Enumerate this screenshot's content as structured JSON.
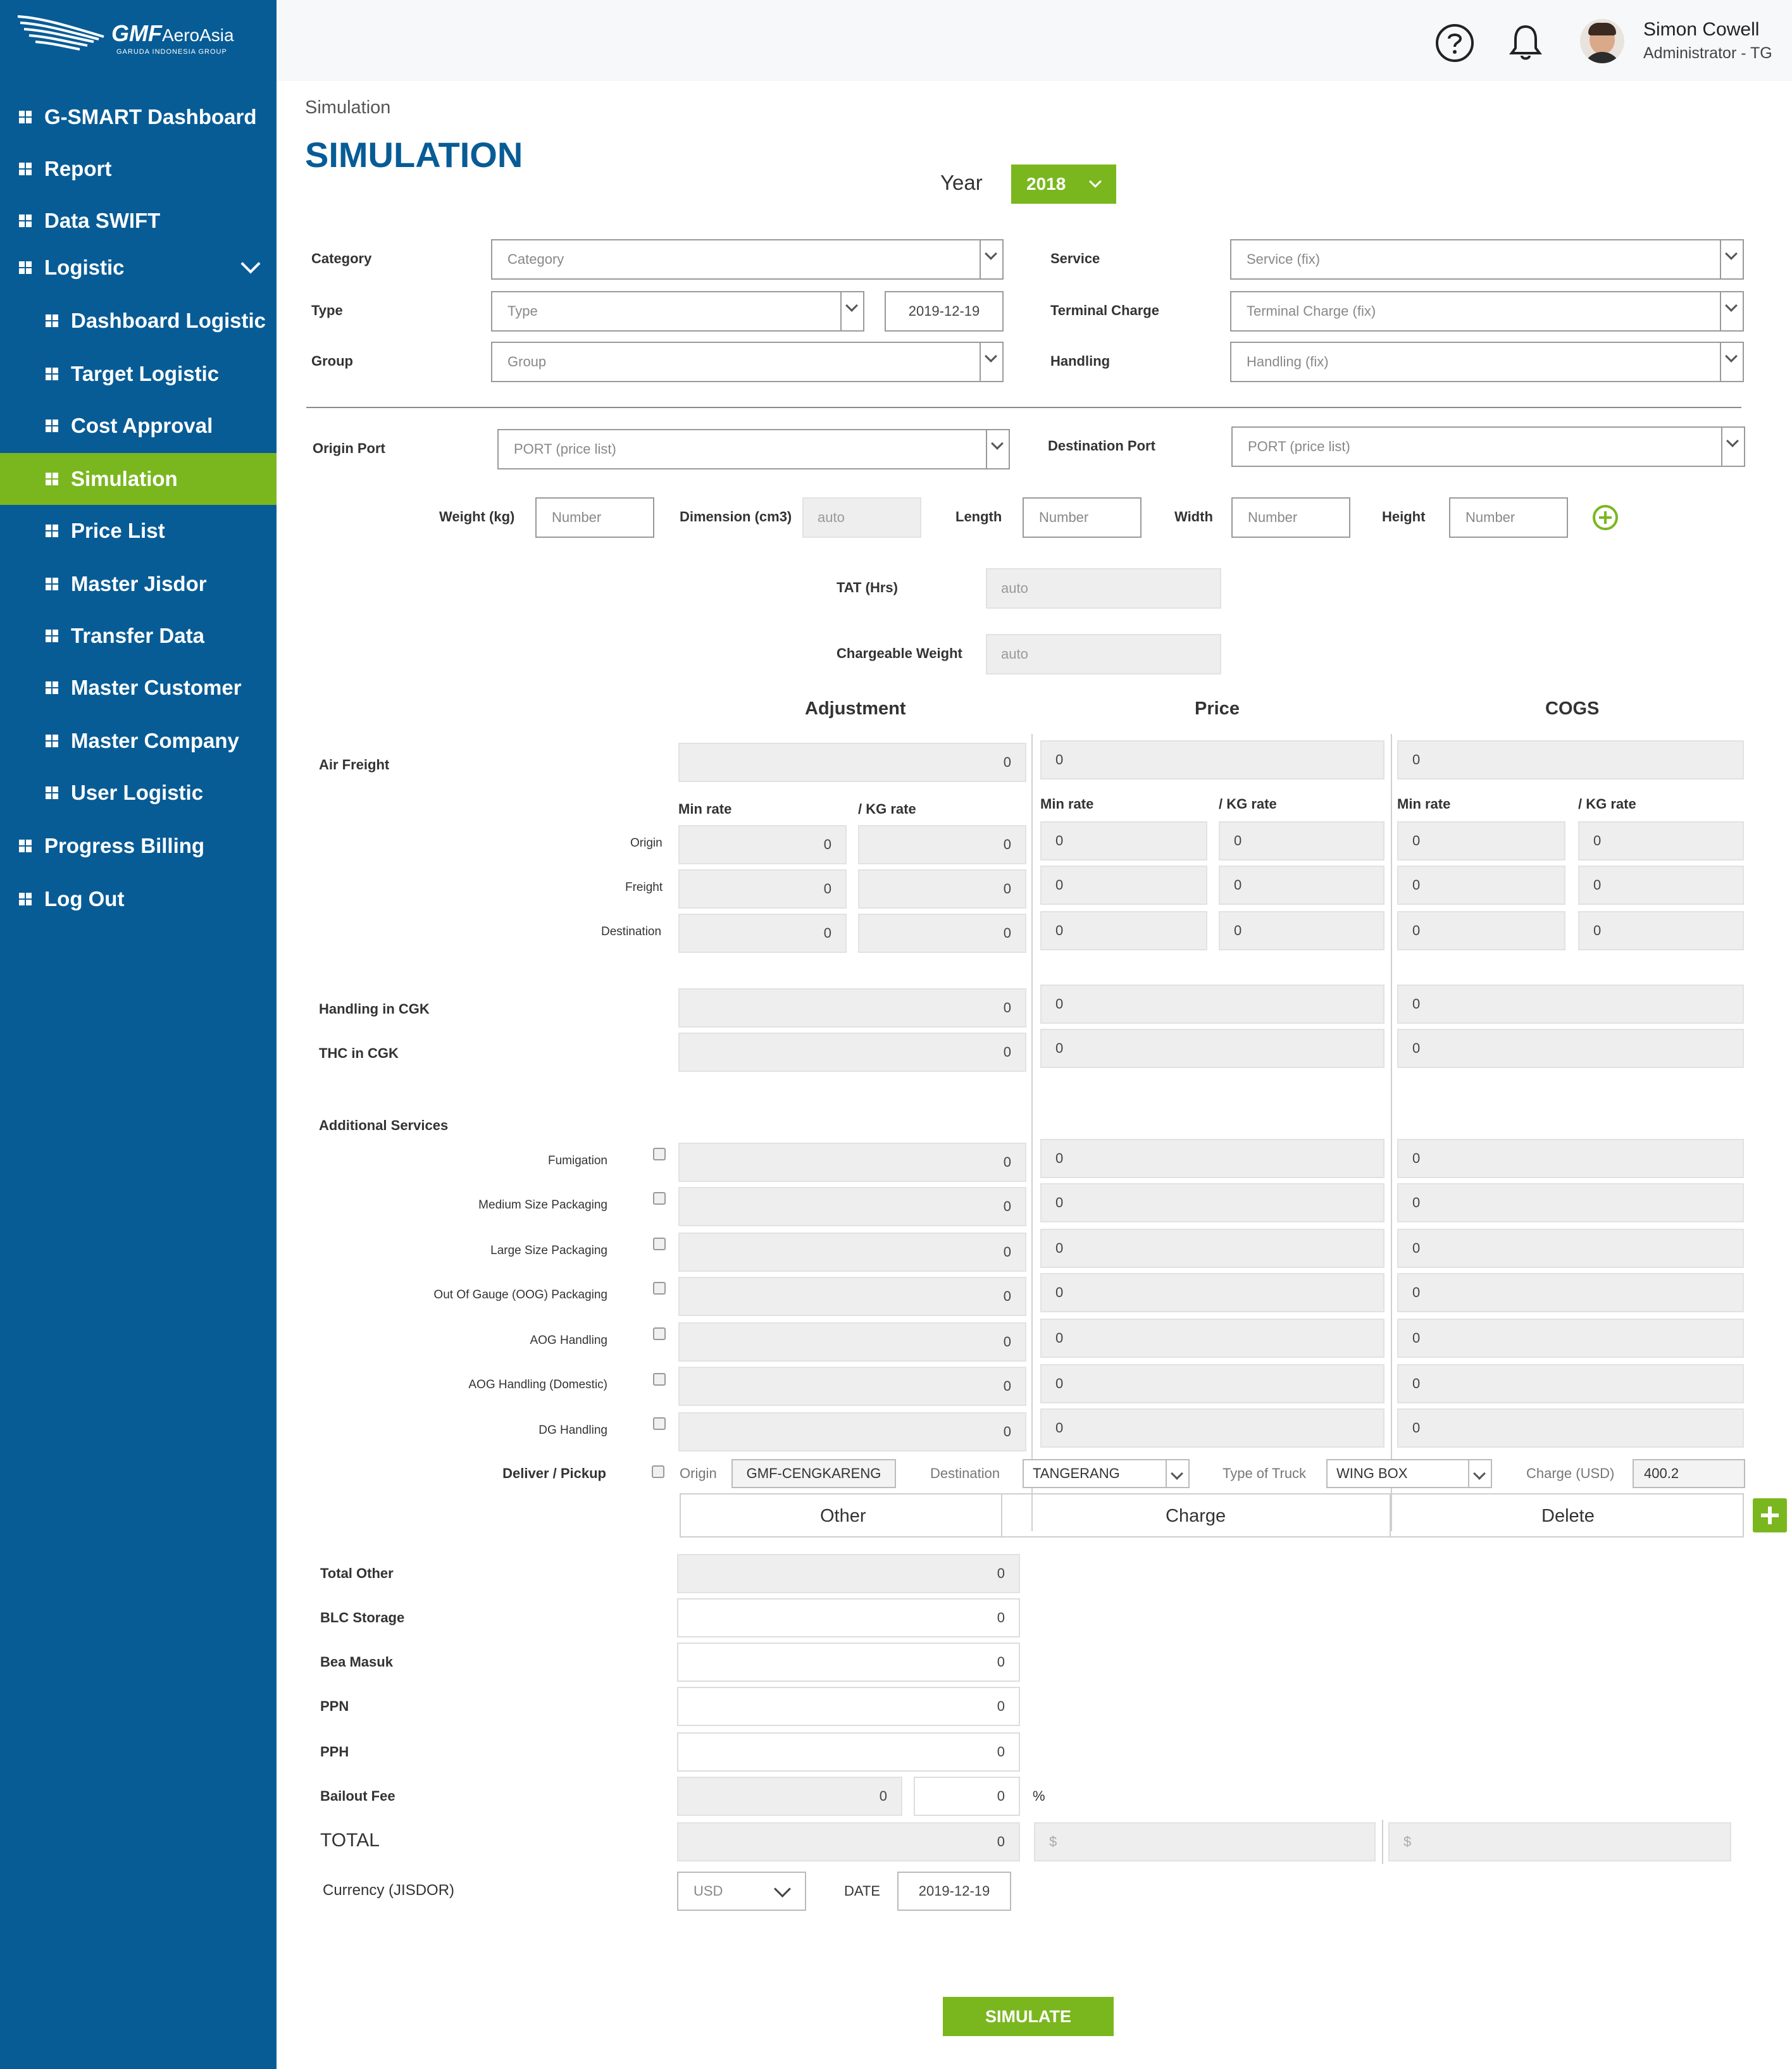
{
  "brand": {
    "name": "GMF AeroAsia",
    "subtitle": "GARUDA INDONESIA GROUP",
    "wordmark_main": "GMF",
    "wordmark_sub": "AeroAsia"
  },
  "colors": {
    "sidebar": "#075c96",
    "accent_green": "#7ab71f",
    "title_blue": "#075c96"
  },
  "sidebar": {
    "items": [
      {
        "label": "G-SMART Dashboard",
        "icon": "grid-icon"
      },
      {
        "label": "Report",
        "icon": "grid-icon"
      },
      {
        "label": "Data SWIFT",
        "icon": "grid-icon"
      },
      {
        "label": "Logistic",
        "icon": "grid-icon",
        "expanded": true
      },
      {
        "label": "Dashboard Logistic",
        "icon": "grid-icon"
      },
      {
        "label": "Target Logistic",
        "icon": "grid-icon"
      },
      {
        "label": "Cost Approval",
        "icon": "grid-icon"
      },
      {
        "label": "Simulation",
        "icon": "grid-icon",
        "active": true
      },
      {
        "label": "Price List",
        "icon": "grid-icon"
      },
      {
        "label": "Master Jisdor",
        "icon": "grid-icon"
      },
      {
        "label": "Transfer Data",
        "icon": "grid-icon"
      },
      {
        "label": "Master Customer",
        "icon": "grid-icon"
      },
      {
        "label": "Master Company",
        "icon": "grid-icon"
      },
      {
        "label": "User Logistic",
        "icon": "grid-icon"
      },
      {
        "label": "Progress Billing",
        "icon": "grid-icon"
      },
      {
        "label": "Log Out",
        "icon": "grid-icon"
      }
    ]
  },
  "header": {
    "help_icon": "help-icon",
    "bell_icon": "bell-icon",
    "user_name": "Simon Cowell",
    "user_role": "Administrator - TG"
  },
  "page": {
    "breadcrumb": "Simulation",
    "title": "SIMULATION",
    "year_label": "Year",
    "year_value": "2018"
  },
  "form": {
    "category_label": "Category",
    "category_placeholder": "Category",
    "type_label": "Type",
    "type_placeholder": "Type",
    "type_date": "2019-12-19",
    "group_label": "Group",
    "group_placeholder": "Group",
    "service_label": "Service",
    "service_value": "Service (fix)",
    "terminal_label": "Terminal Charge",
    "terminal_value": "Terminal Charge (fix)",
    "handling_label": "Handling",
    "handling_value": "Handling (fix)",
    "origin_port_label": "Origin Port",
    "origin_port_value": "PORT (price list)",
    "dest_port_label": "Destination Port",
    "dest_port_value": "PORT (price list)",
    "weight_label": "Weight (kg)",
    "weight_placeholder": "Number",
    "dimension_label": "Dimension (cm3)",
    "dimension_value": "auto",
    "length_label": "Length",
    "length_placeholder": "Number",
    "width_label": "Width",
    "width_placeholder": "Number",
    "height_label": "Height",
    "height_placeholder": "Number",
    "tat_label": "TAT (Hrs)",
    "tat_value": "auto",
    "chargeable_label": "Chargeable Weight",
    "chargeable_value": "auto"
  },
  "columns": {
    "adjustment": "Adjustment",
    "price": "Price",
    "cogs": "COGS",
    "min_rate": "Min rate",
    "kg_rate": "/ KG rate"
  },
  "air_freight": {
    "label": "Air Freight",
    "adj_total": "0",
    "price_total": "0",
    "cogs_total": "0",
    "rows": [
      {
        "label": "Origin",
        "adj_min": "0",
        "adj_kg": "0",
        "price_min": "0",
        "price_kg": "0",
        "cogs_min": "0",
        "cogs_kg": "0"
      },
      {
        "label": "Freight",
        "adj_min": "0",
        "adj_kg": "0",
        "price_min": "0",
        "price_kg": "0",
        "cogs_min": "0",
        "cogs_kg": "0"
      },
      {
        "label": "Destination",
        "adj_min": "0",
        "adj_kg": "0",
        "price_min": "0",
        "price_kg": "0",
        "cogs_min": "0",
        "cogs_kg": "0"
      }
    ]
  },
  "handling_rows": [
    {
      "label": "Handling in CGK",
      "adj": "0",
      "price": "0",
      "cogs": "0"
    },
    {
      "label": "THC in CGK",
      "adj": "0",
      "price": "0",
      "cogs": "0"
    }
  ],
  "additional": {
    "label": "Additional Services",
    "rows": [
      {
        "label": "Fumigation",
        "adj": "0",
        "price": "0",
        "cogs": "0"
      },
      {
        "label": "Medium Size Packaging",
        "adj": "0",
        "price": "0",
        "cogs": "0"
      },
      {
        "label": "Large Size Packaging",
        "adj": "0",
        "price": "0",
        "cogs": "0"
      },
      {
        "label": "Out Of Gauge (OOG) Packaging",
        "adj": "0",
        "price": "0",
        "cogs": "0"
      },
      {
        "label": "AOG Handling",
        "adj": "0",
        "price": "0",
        "cogs": "0"
      },
      {
        "label": "AOG Handling (Domestic)",
        "adj": "0",
        "price": "0",
        "cogs": "0"
      },
      {
        "label": "DG Handling",
        "adj": "0",
        "price": "0",
        "cogs": "0"
      }
    ]
  },
  "deliver": {
    "label": "Deliver / Pickup",
    "origin_label": "Origin",
    "origin_value": "GMF-CENGKARENG",
    "destination_label": "Destination",
    "destination_value": "TANGERANG",
    "truck_label": "Type of Truck",
    "truck_value": "WING BOX",
    "charge_label": "Charge (USD)",
    "charge_value": "400.2"
  },
  "other_table": {
    "col_other": "Other",
    "col_charge": "Charge",
    "col_delete": "Delete",
    "add_icon": "plus-icon"
  },
  "totals": {
    "total_other_label": "Total Other",
    "total_other": "0",
    "blc_label": "BLC Storage",
    "blc": "0",
    "bea_label": "Bea Masuk",
    "bea": "0",
    "ppn_label": "PPN",
    "ppn": "0",
    "pph_label": "PPH",
    "pph": "0",
    "bailout_label": "Bailout Fee",
    "bailout": "0",
    "bailout_pct": "0",
    "pct_sign": "%",
    "total_label": "TOTAL",
    "total": "0",
    "total_price": "$",
    "total_cogs": "$",
    "currency_label": "Currency (JISDOR)",
    "currency_value": "USD",
    "date_label": "DATE",
    "date_value": "2019-12-19"
  },
  "simulate_button": "SIMULATE"
}
